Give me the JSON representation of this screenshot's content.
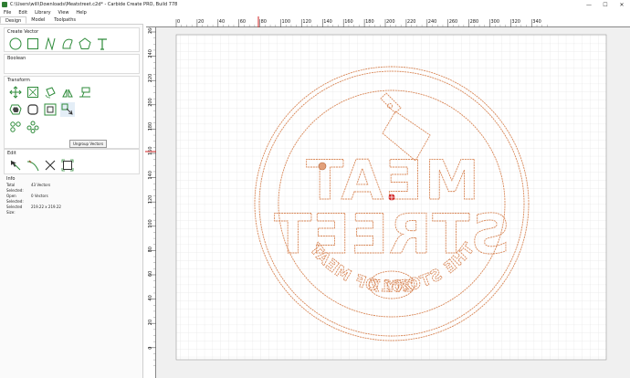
{
  "window": {
    "title": "C:\\Users\\will\\Downloads\\Meatstreet.c2d* - Carbide Create PRO, Build 778",
    "controls": [
      "—",
      "☐",
      "✕"
    ]
  },
  "menu": [
    "File",
    "Edit",
    "Library",
    "View",
    "Help"
  ],
  "tabs": [
    "Design",
    "Model",
    "Toolpaths"
  ],
  "sections": {
    "create_vector": "Create Vector",
    "boolean": "Boolean",
    "transform": "Transform",
    "edit": "Edit",
    "info": "Info"
  },
  "tooltip": "Ungroup Vectors",
  "info": {
    "rows": [
      {
        "label": "Total Selected:",
        "value": "43 Vectors"
      },
      {
        "label": "Open Selected:",
        "value": "0 Vectors"
      },
      {
        "label": "Selected Size:",
        "value": "219.22 x 219.22"
      }
    ]
  },
  "ruler": {
    "x_labels": [
      "0",
      "20",
      "40",
      "60",
      "80",
      "100",
      "120",
      "140",
      "160",
      "180",
      "200",
      "220",
      "240",
      "260",
      "280",
      "300",
      "320",
      "340"
    ],
    "y_labels": [
      "260",
      "240",
      "220",
      "200",
      "180",
      "160",
      "140",
      "120",
      "100",
      "80",
      "60",
      "40",
      "20",
      "0"
    ]
  },
  "artwork": {
    "word1": "MEAT",
    "word2": "STREET",
    "tagline": "THE STORY OF MEAT",
    "year": "2017"
  },
  "colors": {
    "vector": "#d9895a",
    "tool_icon": "#2e8b3a",
    "grid": "#d8d8d8",
    "cursor": "#d02020"
  }
}
